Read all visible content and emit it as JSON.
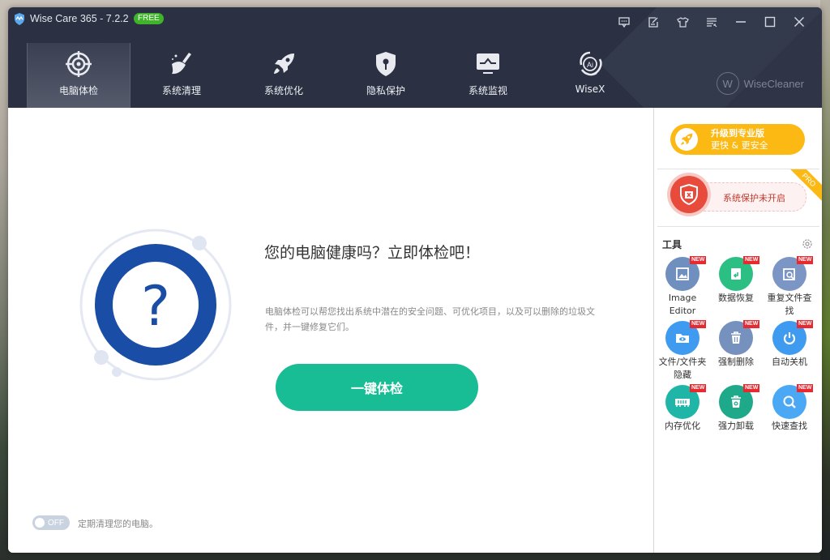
{
  "window": {
    "title": "Wise Care 365 - 7.2.2",
    "badge": "FREE",
    "controls": [
      "feedback-icon",
      "notes-icon",
      "skin-icon",
      "menu-icon",
      "minimize-icon",
      "maximize-icon",
      "close-icon"
    ]
  },
  "nav": {
    "items": [
      {
        "label": "电脑体检",
        "icon": "target-icon",
        "active": true
      },
      {
        "label": "系统清理",
        "icon": "broom-icon",
        "active": false
      },
      {
        "label": "系统优化",
        "icon": "rocket-icon",
        "active": false
      },
      {
        "label": "隐私保护",
        "icon": "shield-lock-icon",
        "active": false
      },
      {
        "label": "系统监视",
        "icon": "monitor-icon",
        "active": false
      },
      {
        "label": "WiseX",
        "icon": "ai-icon",
        "active": false
      }
    ],
    "brand": "WiseCleaner",
    "brand_letter": "W"
  },
  "main": {
    "headline": "您的电脑健康吗？立即体检吧！",
    "description": "电脑体检可以帮您找出系统中潜在的安全问题、可优化项目，以及可以删除的垃圾文件，并一键修复它们。",
    "scan_button": "一键体检",
    "question_mark": "?",
    "auto_clean": {
      "state": "OFF",
      "label": "定期清理您的电脑。"
    }
  },
  "sidebar": {
    "upgrade": {
      "line1": "升级到专业版",
      "line2": "更快 & 更安全"
    },
    "protection": {
      "text": "系统保护未开启",
      "ribbon": "PRO"
    },
    "tools_title": "工具",
    "tools": [
      {
        "label": "Image Editor",
        "badge": "NEW",
        "icon": "image-icon",
        "color": "#6f8fbf"
      },
      {
        "label": "数据恢复",
        "badge": "NEW",
        "icon": "data-recovery-icon",
        "color": "#2bbf84"
      },
      {
        "label": "重复文件查找",
        "badge": "NEW",
        "icon": "duplicate-finder-icon",
        "color": "#7b96c4"
      },
      {
        "label": "文件/文件夹隐藏",
        "badge": "NEW",
        "icon": "folder-hide-icon",
        "color": "#3e9bef"
      },
      {
        "label": "强制删除",
        "badge": "NEW",
        "icon": "trash-icon",
        "color": "#7791bf"
      },
      {
        "label": "自动关机",
        "badge": "NEW",
        "icon": "power-icon",
        "color": "#3e9bef"
      },
      {
        "label": "内存优化",
        "badge": "NEW",
        "icon": "memory-icon",
        "color": "#1fb6a8"
      },
      {
        "label": "强力卸载",
        "badge": "NEW",
        "icon": "uninstall-icon",
        "color": "#1ea98a"
      },
      {
        "label": "快速查找",
        "badge": "NEW",
        "icon": "search-icon",
        "color": "#4aa8f5"
      }
    ]
  },
  "colors": {
    "header_bg": "#2b3142",
    "accent_green": "#18bd95",
    "upgrade_yellow": "#fdb913",
    "alert_red": "#e84b3c",
    "health_blue": "#1a4ea6",
    "new_badge": "#e8292f"
  }
}
